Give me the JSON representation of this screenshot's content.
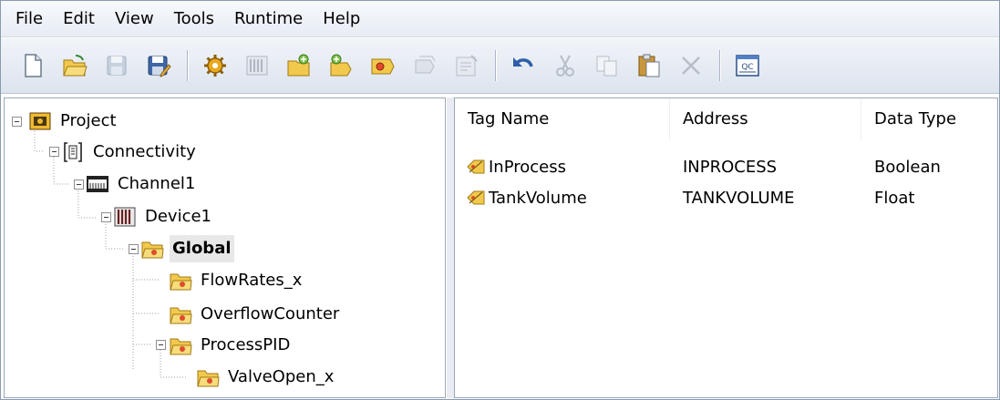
{
  "menubar": {
    "items": [
      "File",
      "Edit",
      "View",
      "Tools",
      "Runtime",
      "Help"
    ]
  },
  "toolbar": {
    "buttons": [
      {
        "icon": "new-icon",
        "enabled": true
      },
      {
        "icon": "open-folder-icon",
        "enabled": true
      },
      {
        "icon": "save-icon",
        "enabled": false
      },
      {
        "icon": "save-as-icon",
        "enabled": true
      },
      {
        "icon": "new-channel-icon",
        "enabled": true
      },
      {
        "icon": "new-device-icon",
        "enabled": false
      },
      {
        "icon": "new-tag-group-icon",
        "enabled": true
      },
      {
        "icon": "new-tag-icon",
        "enabled": true
      },
      {
        "icon": "bulk-tag-icon",
        "enabled": true
      },
      {
        "icon": "duplicate-tag-icon",
        "enabled": false
      },
      {
        "icon": "properties-icon",
        "enabled": false
      },
      {
        "icon": "undo-icon",
        "enabled": true
      },
      {
        "icon": "cut-icon",
        "enabled": false
      },
      {
        "icon": "copy-icon",
        "enabled": false
      },
      {
        "icon": "paste-icon",
        "enabled": true
      },
      {
        "icon": "delete-icon",
        "enabled": false
      },
      {
        "icon": "quick-client-icon",
        "enabled": true
      }
    ]
  },
  "tree": {
    "nodes": [
      {
        "label": "Project",
        "icon": "project-icon",
        "expanded": true
      },
      {
        "label": "Connectivity",
        "icon": "connectivity-icon",
        "expanded": true
      },
      {
        "label": "Channel1",
        "icon": "channel-icon",
        "expanded": true
      },
      {
        "label": "Device1",
        "icon": "device-icon",
        "expanded": true
      },
      {
        "label": "Global",
        "icon": "tag-group-folder-icon",
        "expanded": true,
        "selected": true
      },
      {
        "label": "FlowRates_x",
        "icon": "tag-group-folder-icon"
      },
      {
        "label": "OverflowCounter",
        "icon": "tag-group-folder-icon"
      },
      {
        "label": "ProcessPID",
        "icon": "tag-group-folder-icon",
        "expanded": true
      },
      {
        "label": "ValveOpen_x",
        "icon": "tag-group-folder-icon"
      }
    ]
  },
  "list": {
    "columns": [
      "Tag Name",
      "Address",
      "Data Type"
    ],
    "rows": [
      {
        "name": "InProcess",
        "address": "INPROCESS",
        "type": "Boolean",
        "icon": "tag-icon"
      },
      {
        "name": "TankVolume",
        "address": "TANKVOLUME",
        "type": "Float",
        "icon": "tag-icon"
      }
    ]
  },
  "colors": {
    "menubar": "#e7ecf4",
    "toolbar": "#dde4ee",
    "folder": "#f2c94c",
    "selection": "#e8e8e8"
  }
}
